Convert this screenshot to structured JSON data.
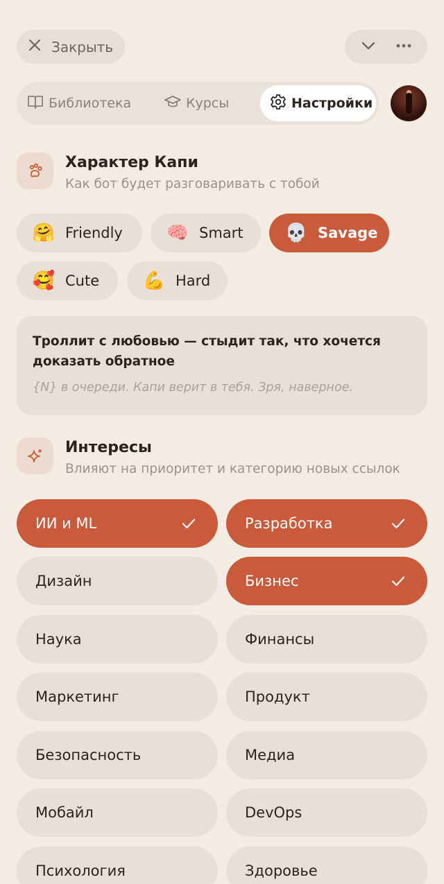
{
  "header": {
    "close_label": "Закрыть"
  },
  "tabs": {
    "library": "Библиотека",
    "courses": "Курсы",
    "settings": "Настройки"
  },
  "character": {
    "title": "Характер Капи",
    "subtitle": "Как бот будет разговаривать с тобой",
    "options": [
      {
        "emoji": "🤗",
        "label": "Friendly",
        "selected": false
      },
      {
        "emoji": "🧠",
        "label": "Smart",
        "selected": false
      },
      {
        "emoji": "💀",
        "label": "Savage",
        "selected": true
      },
      {
        "emoji": "🥰",
        "label": "Cute",
        "selected": false
      },
      {
        "emoji": "💪",
        "label": "Hard",
        "selected": false
      }
    ],
    "description": "Троллит с любовью — стыдит так, что хочется доказать обратное",
    "description_hint": "{N} в очереди. Капи верит в тебя. Зря, наверное."
  },
  "interests": {
    "title": "Интересы",
    "subtitle": "Влияют на приоритет и категорию новых ссылок",
    "items": [
      {
        "label": "ИИ и ML",
        "selected": true
      },
      {
        "label": "Разработка",
        "selected": true
      },
      {
        "label": "Дизайн",
        "selected": false
      },
      {
        "label": "Бизнес",
        "selected": true
      },
      {
        "label": "Наука",
        "selected": false
      },
      {
        "label": "Финансы",
        "selected": false
      },
      {
        "label": "Маркетинг",
        "selected": false
      },
      {
        "label": "Продукт",
        "selected": false
      },
      {
        "label": "Безопасность",
        "selected": false
      },
      {
        "label": "Медиа",
        "selected": false
      },
      {
        "label": "Мобайл",
        "selected": false
      },
      {
        "label": "DevOps",
        "selected": false
      },
      {
        "label": "Психология",
        "selected": false
      },
      {
        "label": "Здоровье",
        "selected": false
      }
    ]
  },
  "colors": {
    "accent": "#c95a3a",
    "background": "#f3ece3",
    "chip": "#e8e0d6"
  }
}
